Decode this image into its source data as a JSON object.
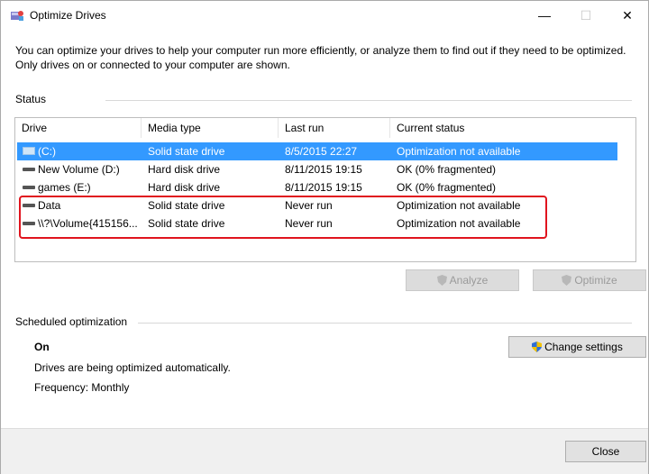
{
  "window": {
    "title": "Optimize Drives",
    "minimize_glyph": "—",
    "maximize_glyph": "☐",
    "close_glyph": "✕"
  },
  "description": "You can optimize your drives to help your computer run more efficiently, or analyze them to find out if they need to be optimized. Only drives on or connected to your computer are shown.",
  "status": {
    "label": "Status",
    "columns": [
      "Drive",
      "Media type",
      "Last run",
      "Current status"
    ],
    "rows": [
      {
        "drive": "(C:)",
        "media": "Solid state drive",
        "last_run": "8/5/2015 22:27",
        "status": "Optimization not available",
        "icon": "system-drive-icon",
        "selected": true
      },
      {
        "drive": "New Volume (D:)",
        "media": "Hard disk drive",
        "last_run": "8/11/2015 19:15",
        "status": "OK (0% fragmented)",
        "icon": "hard-drive-icon",
        "selected": false
      },
      {
        "drive": "games (E:)",
        "media": "Hard disk drive",
        "last_run": "8/11/2015 19:15",
        "status": "OK (0% fragmented)",
        "icon": "hard-drive-icon",
        "selected": false
      },
      {
        "drive": "Data",
        "media": "Solid state drive",
        "last_run": "Never run",
        "status": "Optimization not available",
        "icon": "hard-drive-icon",
        "selected": false
      },
      {
        "drive": "\\\\?\\Volume{415156...",
        "media": "Solid state drive",
        "last_run": "Never run",
        "status": "Optimization not available",
        "icon": "hard-drive-icon",
        "selected": false
      }
    ]
  },
  "buttons": {
    "analyze": "Analyze",
    "optimize": "Optimize",
    "change_settings": "Change settings",
    "close": "Close"
  },
  "scheduled": {
    "label": "Scheduled optimization",
    "state": "On",
    "description": "Drives are being optimized automatically.",
    "frequency": "Frequency: Monthly"
  },
  "colors": {
    "selection": "#3399ff",
    "highlight_box": "#e0141e"
  }
}
